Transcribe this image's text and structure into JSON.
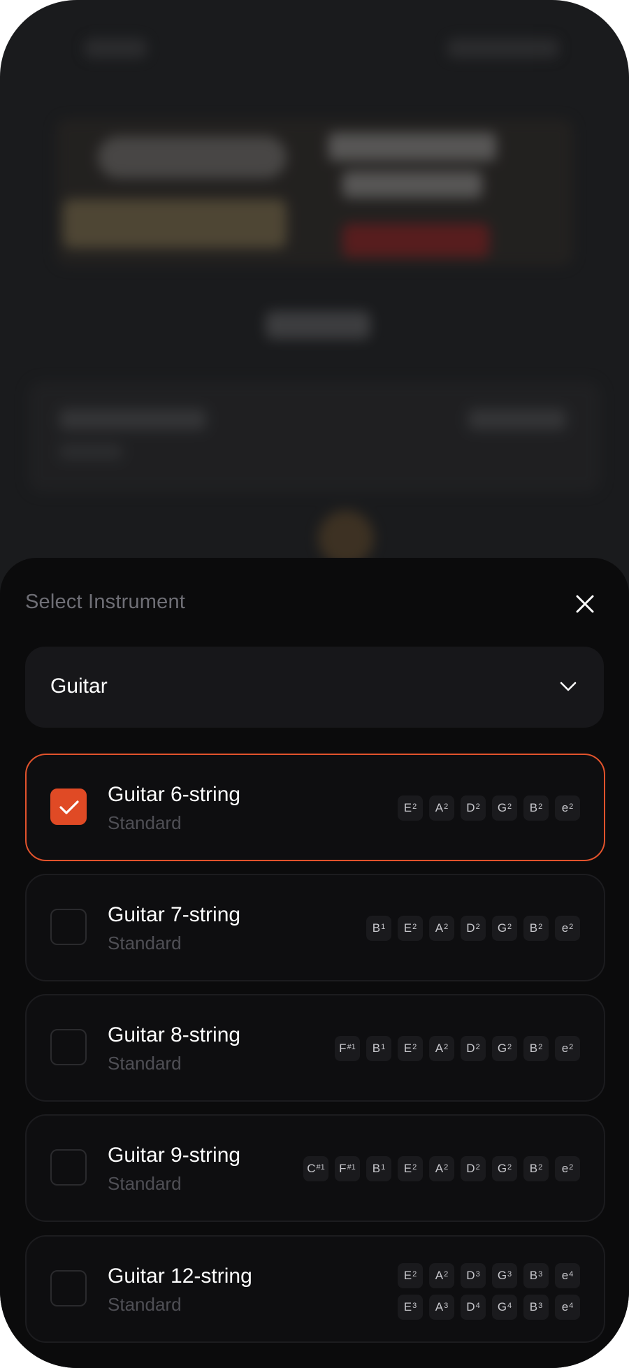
{
  "sheet": {
    "title": "Select Instrument",
    "close_icon": "close-icon"
  },
  "select": {
    "value": "Guitar",
    "icon": "chevron-down-icon"
  },
  "colors": {
    "accent": "#e04a25",
    "sheet_bg": "#0b0b0c",
    "card_bg": "#0e0e10"
  },
  "instruments": [
    {
      "name": "Guitar 6-string",
      "tuning": "Standard",
      "selected": true,
      "rows": [
        [
          [
            "E",
            "2"
          ],
          [
            "A",
            "2"
          ],
          [
            "D",
            "2"
          ],
          [
            "G",
            "2"
          ],
          [
            "B",
            "2"
          ],
          [
            "e",
            "2"
          ]
        ]
      ]
    },
    {
      "name": "Guitar 7-string",
      "tuning": "Standard",
      "selected": false,
      "rows": [
        [
          [
            "B",
            "1"
          ],
          [
            "E",
            "2"
          ],
          [
            "A",
            "2"
          ],
          [
            "D",
            "2"
          ],
          [
            "G",
            "2"
          ],
          [
            "B",
            "2"
          ],
          [
            "e",
            "2"
          ]
        ]
      ]
    },
    {
      "name": "Guitar 8-string",
      "tuning": "Standard",
      "selected": false,
      "rows": [
        [
          [
            "F",
            "#1"
          ],
          [
            "B",
            "1"
          ],
          [
            "E",
            "2"
          ],
          [
            "A",
            "2"
          ],
          [
            "D",
            "2"
          ],
          [
            "G",
            "2"
          ],
          [
            "B",
            "2"
          ],
          [
            "e",
            "2"
          ]
        ]
      ]
    },
    {
      "name": "Guitar 9-string",
      "tuning": "Standard",
      "selected": false,
      "rows": [
        [
          [
            "C",
            "#1"
          ],
          [
            "F",
            "#1"
          ],
          [
            "B",
            "1"
          ],
          [
            "E",
            "2"
          ],
          [
            "A",
            "2"
          ],
          [
            "D",
            "2"
          ],
          [
            "G",
            "2"
          ],
          [
            "B",
            "2"
          ],
          [
            "e",
            "2"
          ]
        ]
      ]
    },
    {
      "name": "Guitar 12-string",
      "tuning": "Standard",
      "selected": false,
      "rows": [
        [
          [
            "E",
            "2"
          ],
          [
            "A",
            "2"
          ],
          [
            "D",
            "3"
          ],
          [
            "G",
            "3"
          ],
          [
            "B",
            "3"
          ],
          [
            "e",
            "4"
          ]
        ],
        [
          [
            "E",
            "3"
          ],
          [
            "A",
            "3"
          ],
          [
            "D",
            "4"
          ],
          [
            "G",
            "4"
          ],
          [
            "B",
            "3"
          ],
          [
            "e",
            "4"
          ]
        ]
      ]
    }
  ]
}
